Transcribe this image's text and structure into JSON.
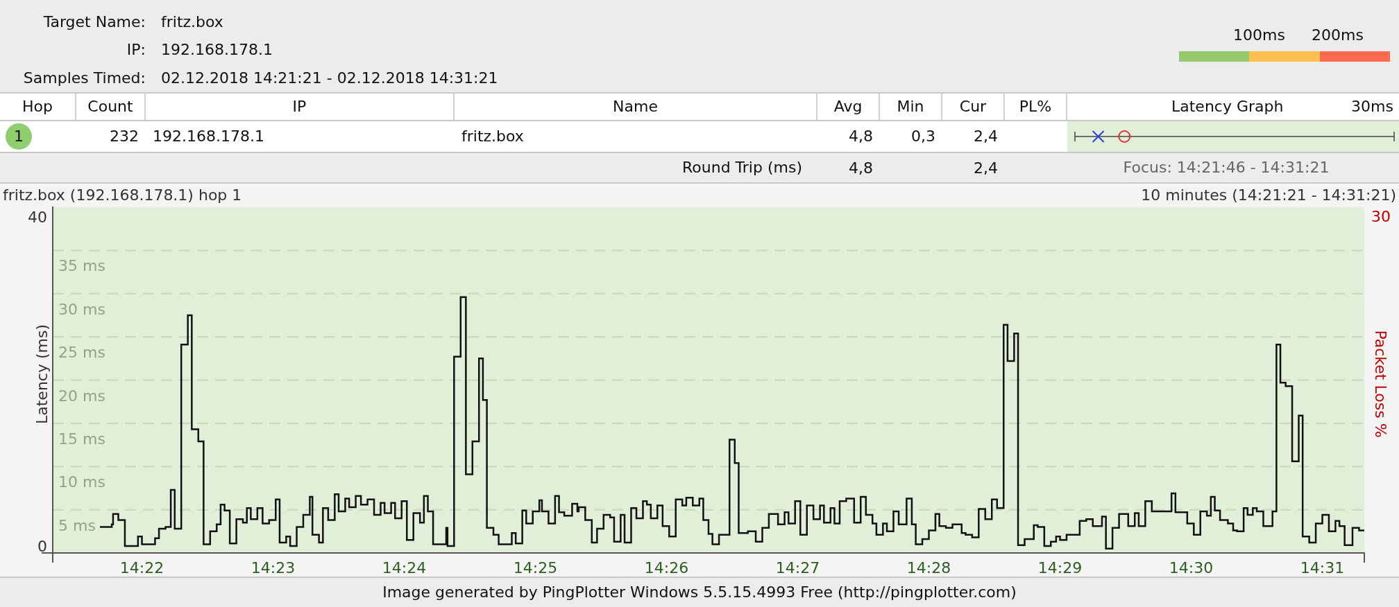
{
  "target": {
    "fields": [
      {
        "label": "Target Name:",
        "value": "fritz.box"
      },
      {
        "label": "IP:",
        "value": "192.168.178.1"
      },
      {
        "label": "Samples Timed:",
        "value": "02.12.2018 14:21:21 - 02.12.2018 14:31:21"
      }
    ]
  },
  "scale_legend": {
    "labels": [
      "100ms",
      "200ms"
    ],
    "segments": [
      {
        "color": "#95c96b"
      },
      {
        "color": "#fdc050"
      },
      {
        "color": "#fd6a50"
      }
    ]
  },
  "table": {
    "columns": [
      {
        "label": "Hop"
      },
      {
        "label": "Count"
      },
      {
        "label": "IP"
      },
      {
        "label": "Name"
      },
      {
        "label": "Avg"
      },
      {
        "label": "Min"
      },
      {
        "label": "Cur"
      },
      {
        "label": "PL%"
      },
      {
        "label": "Latency Graph",
        "scale": "30ms"
      }
    ],
    "rows": [
      {
        "hop": "1",
        "color": "#8fce6e",
        "count": "232",
        "ip": "192.168.178.1",
        "name": "fritz.box",
        "avg": "4,8",
        "min": "0,3",
        "cur": "2,4",
        "markers": [
          {
            "kind": "current",
            "level": 0.073
          },
          {
            "kind": "average",
            "level": 0.155
          }
        ]
      }
    ]
  },
  "summary": {
    "label": "Round Trip (ms)",
    "avg": "4,8",
    "cur": "2,4",
    "focus": "Focus: 14:21:46 - 14:31:21"
  },
  "chart_header": {
    "title": "fritz.box (192.168.178.1) hop 1",
    "range": "10 minutes (14:21:21 - 14:31:21)"
  },
  "chart": {
    "latency_axis_ends": [
      "40",
      "0"
    ],
    "loss_axis_max": "30",
    "loss_label": "Packet Loss %",
    "chart_data": {
      "type": "line",
      "grid": true,
      "ylabel": "Latency (ms)",
      "xlim": [
        861.32,
        871.32
      ],
      "ylim": [
        0,
        40
      ],
      "xticks": [
        {
          "value": 862,
          "label": "14:22"
        },
        {
          "value": 863,
          "label": "14:23"
        },
        {
          "value": 864,
          "label": "14:24"
        },
        {
          "value": 865,
          "label": "14:25"
        },
        {
          "value": 866,
          "label": "14:26"
        },
        {
          "value": 867,
          "label": "14:27"
        },
        {
          "value": 868,
          "label": "14:28"
        },
        {
          "value": 869,
          "label": "14:29"
        },
        {
          "value": 870,
          "label": "14:30"
        },
        {
          "value": 871,
          "label": "14:31"
        }
      ],
      "yticks": [
        {
          "value": 5,
          "label": "5 ms"
        },
        {
          "value": 10,
          "label": "10 ms"
        },
        {
          "value": 15,
          "label": "15 ms"
        },
        {
          "value": 20,
          "label": "20 ms"
        },
        {
          "value": 25,
          "label": "25 ms"
        },
        {
          "value": 30,
          "label": "30 ms"
        },
        {
          "value": 35,
          "label": "35 ms"
        }
      ],
      "x": [
        861.68,
        861.77,
        861.78,
        861.82,
        861.87,
        861.97,
        862.0,
        862.1,
        862.13,
        862.18,
        862.22,
        862.25,
        862.3,
        862.35,
        862.38,
        862.43,
        862.47,
        862.52,
        862.57,
        862.6,
        862.63,
        862.67,
        862.72,
        862.77,
        862.8,
        862.83,
        862.88,
        862.92,
        862.97,
        863.02,
        863.05,
        863.1,
        863.13,
        863.18,
        863.23,
        863.28,
        863.3,
        863.35,
        863.38,
        863.42,
        863.47,
        863.5,
        863.55,
        863.58,
        863.63,
        863.67,
        863.72,
        863.77,
        863.82,
        863.85,
        863.9,
        863.93,
        863.98,
        864.02,
        864.07,
        864.12,
        864.15,
        864.18,
        864.22,
        864.31,
        864.32,
        864.33,
        864.38,
        864.43,
        864.47,
        864.52,
        864.57,
        864.6,
        864.63,
        864.68,
        864.72,
        864.82,
        864.85,
        864.9,
        864.93,
        864.98,
        865.03,
        865.05,
        865.1,
        865.15,
        865.18,
        865.22,
        865.28,
        865.32,
        865.33,
        865.38,
        865.43,
        865.47,
        865.52,
        865.57,
        865.6,
        865.65,
        865.68,
        865.73,
        865.77,
        865.82,
        865.85,
        865.88,
        865.93,
        865.97,
        866.02,
        866.07,
        866.12,
        866.15,
        866.2,
        866.25,
        866.28,
        866.32,
        866.35,
        866.4,
        866.47,
        866.48,
        866.51,
        866.52,
        866.55,
        866.62,
        866.68,
        866.73,
        866.78,
        866.85,
        866.9,
        866.93,
        866.98,
        867.02,
        867.07,
        867.12,
        867.17,
        867.2,
        867.25,
        867.28,
        867.32,
        867.37,
        867.43,
        867.48,
        867.52,
        867.57,
        867.6,
        867.65,
        867.68,
        867.73,
        867.77,
        867.83,
        867.87,
        867.9,
        867.95,
        868.0,
        868.05,
        868.08,
        868.13,
        868.18,
        868.25,
        868.28,
        868.33,
        868.38,
        868.43,
        868.48,
        868.52,
        868.57,
        868.6,
        868.65,
        868.68,
        868.73,
        868.8,
        868.83,
        868.88,
        868.93,
        868.97,
        869.0,
        869.05,
        869.14,
        869.15,
        869.2,
        869.25,
        869.32,
        869.35,
        869.4,
        869.45,
        869.48,
        869.52,
        869.57,
        869.6,
        869.65,
        869.7,
        869.77,
        869.85,
        869.88,
        869.97,
        870.02,
        870.07,
        870.12,
        870.15,
        870.18,
        870.22,
        870.28,
        870.32,
        870.35,
        870.4,
        870.43,
        870.47,
        870.5,
        870.55,
        870.62,
        870.65,
        870.68,
        870.72,
        870.77,
        870.82,
        870.85,
        870.9,
        870.95,
        871.0,
        871.05,
        871.1,
        871.13,
        871.17,
        871.23,
        871.28,
        871.32
      ],
      "series": [
        {
          "color": "#111111",
          "values": [
            3.0,
            3.3,
            4.5,
            3.8,
            0.8,
            1.9,
            1.0,
            1.7,
            2.8,
            3.0,
            7.3,
            2.8,
            24.1,
            27.5,
            14.3,
            12.9,
            1.0,
            2.5,
            3.3,
            5.6,
            4.9,
            1.1,
            3.9,
            3.5,
            5.2,
            3.9,
            5.2,
            3.4,
            3.8,
            6.2,
            1.2,
            1.9,
            0.8,
            3.0,
            4.4,
            6.5,
            2.1,
            1.2,
            5.2,
            3.8,
            6.8,
            4.8,
            6.3,
            5.3,
            6.6,
            5.6,
            6.2,
            4.4,
            5.8,
            4.6,
            5.8,
            4.0,
            6.0,
            1.5,
            4.6,
            3.5,
            6.6,
            4.8,
            1.0,
            1.0,
            2.9,
            0.8,
            22.7,
            29.6,
            9.1,
            12.9,
            22.5,
            17.7,
            2.9,
            2.1,
            1.0,
            2.3,
            1.1,
            4.9,
            3.4,
            4.8,
            6.1,
            4.8,
            3.4,
            6.6,
            4.7,
            4.3,
            5.7,
            4.8,
            5.3,
            3.8,
            1.2,
            2.8,
            4.4,
            4.1,
            1.3,
            4.4,
            1.2,
            5.2,
            4.0,
            6.0,
            5.6,
            4.0,
            5.5,
            3.1,
            1.9,
            6.2,
            5.5,
            6.4,
            5.5,
            6.3,
            3.8,
            2.2,
            1.0,
            2.1,
            2.1,
            13.1,
            13.1,
            10.4,
            2.3,
            2.5,
            1.3,
            2.9,
            4.5,
            3.3,
            4.7,
            3.4,
            6.0,
            2.1,
            5.5,
            3.9,
            5.5,
            3.5,
            5.2,
            3.4,
            6.0,
            6.3,
            3.5,
            6.5,
            4.4,
            3.4,
            2.1,
            3.4,
            2.5,
            4.8,
            3.3,
            6.3,
            3.3,
            1.0,
            1.6,
            2.6,
            4.5,
            3.1,
            2.9,
            3.3,
            2.3,
            2.1,
            1.8,
            5.1,
            3.9,
            6.2,
            5.2,
            26.4,
            22.2,
            25.4,
            0.9,
            1.6,
            3.2,
            3.0,
            0.8,
            1.3,
            1.9,
            1.5,
            2.1,
            2.1,
            3.7,
            3.9,
            3.1,
            4.2,
            0.5,
            2.9,
            4.5,
            4.5,
            3.1,
            4.6,
            3.1,
            6.0,
            4.8,
            4.8,
            6.9,
            4.7,
            3.4,
            2.1,
            4.8,
            4.3,
            6.5,
            4.9,
            3.8,
            3.4,
            2.6,
            2.5,
            5.2,
            4.4,
            5.2,
            4.8,
            3.1,
            4.8,
            24.1,
            19.7,
            19.3,
            10.6,
            15.9,
            1.9,
            1.2,
            3.4,
            4.4,
            2.5,
            3.7,
            3.1,
            0.9,
            2.9,
            2.6,
            2.6
          ]
        }
      ]
    }
  },
  "footer": "Image generated by PingPlotter Windows 5.5.15.4993 Free (http://pingplotter.com)"
}
